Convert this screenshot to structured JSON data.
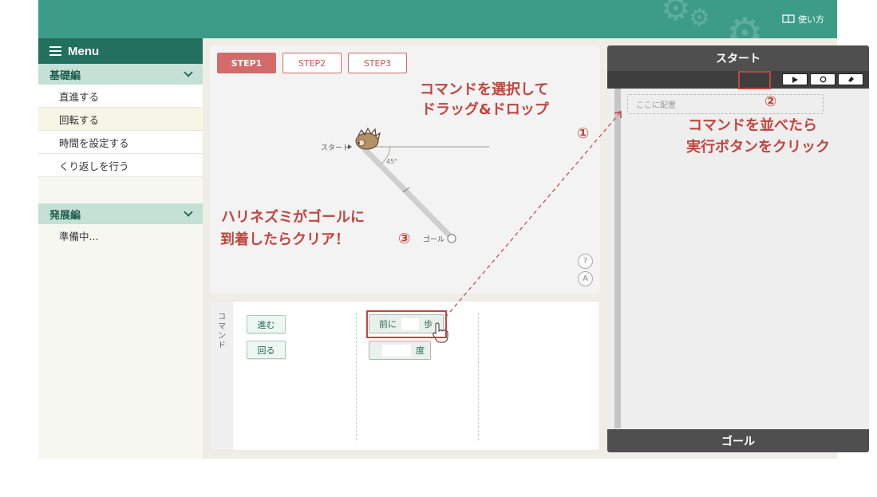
{
  "header": {
    "help_label": "使い方",
    "help_icon": "book-icon",
    "accent": "#3d9c88"
  },
  "sidebar": {
    "menu_label": "Menu",
    "sections": [
      {
        "title": "基礎編",
        "items": [
          "直進する",
          "回転する",
          "時間を設定する",
          "くり返しを行う"
        ]
      },
      {
        "title": "発展編",
        "items": [
          "準備中..."
        ]
      }
    ],
    "active_item": "回転する"
  },
  "stage": {
    "steps": [
      "STEP1",
      "STEP2",
      "STEP3"
    ],
    "active_step": "STEP1",
    "start_label": "スタート",
    "goal_label": "ゴール",
    "angle_label": "45°",
    "help_button": "?",
    "answer_button": "A"
  },
  "commands": {
    "panel_label": "コマンド",
    "basic": [
      "進む",
      "回る"
    ],
    "move_before": "前に",
    "move_after": "歩",
    "turn_unit": "度"
  },
  "program": {
    "start_label": "スタート",
    "goal_label": "ゴール",
    "drop_placeholder": "ここに配置",
    "tools": [
      "run",
      "reset",
      "clear"
    ]
  },
  "annotations": {
    "drag_line1": "コマンドを選択して",
    "drag_line2": "ドラッグ&ドロップ",
    "num1": "①",
    "run_line1": "コマンドを並べたら",
    "run_line2": "実行ボタンをクリック",
    "num2": "②",
    "goal_line1": "ハリネズミがゴールに",
    "goal_line2": "到着したらクリア！",
    "num3": "③",
    "color": "#c0463e"
  }
}
